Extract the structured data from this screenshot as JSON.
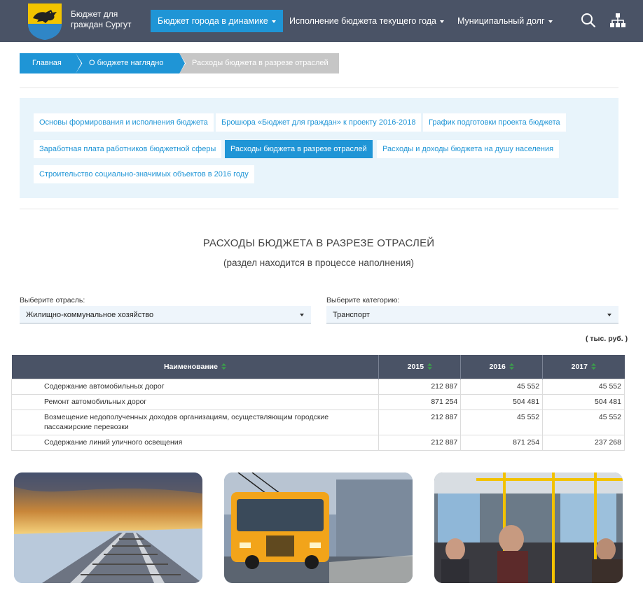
{
  "header": {
    "logo_line1": "Бюджет для",
    "logo_line2": "граждан Сургут",
    "nav": [
      {
        "label": "Бюджет города в динамике"
      },
      {
        "label": "Исполнение бюджета текущего года"
      },
      {
        "label": "Муниципальный долг"
      }
    ]
  },
  "breadcrumb": [
    "Главная",
    "О бюджете наглядно",
    "Расходы бюджета в разрезе отраслей"
  ],
  "links": [
    "Основы формирования и исполнения бюджета",
    "Брошюра «Бюджет для граждан» к проекту 2016-2018",
    "График подготовки проекта бюджета",
    "Заработная плата работников бюджетной сферы",
    "Расходы бюджета в разрезе отраслей",
    "Расходы и доходы бюджета на душу населения",
    "Строительство социально-значимых объектов в 2016 году"
  ],
  "page": {
    "title": "РАСХОДЫ БЮДЖЕТА В РАЗРЕЗЕ ОТРАСЛЕЙ",
    "subtitle": "(раздел находится в процессе наполнения)"
  },
  "filters": {
    "sector_label": "Выберите отрасль:",
    "sector_value": "Жилищно-коммунальное хозяйство",
    "category_label": "Выберите категорию:",
    "category_value": "Транспорт"
  },
  "units": "( тыс. руб. )",
  "table": {
    "headers": [
      "Наименование",
      "2015",
      "2016",
      "2017"
    ],
    "rows": [
      [
        "Содержание автомобильных дорог",
        "212 887",
        "45 552",
        "45 552"
      ],
      [
        "Ремонт автомобильных дорог",
        "871 254",
        "504 481",
        "504 481"
      ],
      [
        "Возмещение недополученных доходов организациям, осуществляющим городские пассажирские перевозки",
        "212 887",
        "45 552",
        "45 552"
      ],
      [
        "Содержание линий уличного освещения",
        "212 887",
        "871 254",
        "237 268"
      ]
    ]
  },
  "colors": {
    "header_bg": "#4a5366",
    "accent": "#1f95d6",
    "panel_bg": "#e8f4fb"
  },
  "icons": [
    "search-icon",
    "sitemap-icon",
    "sort-icon"
  ]
}
